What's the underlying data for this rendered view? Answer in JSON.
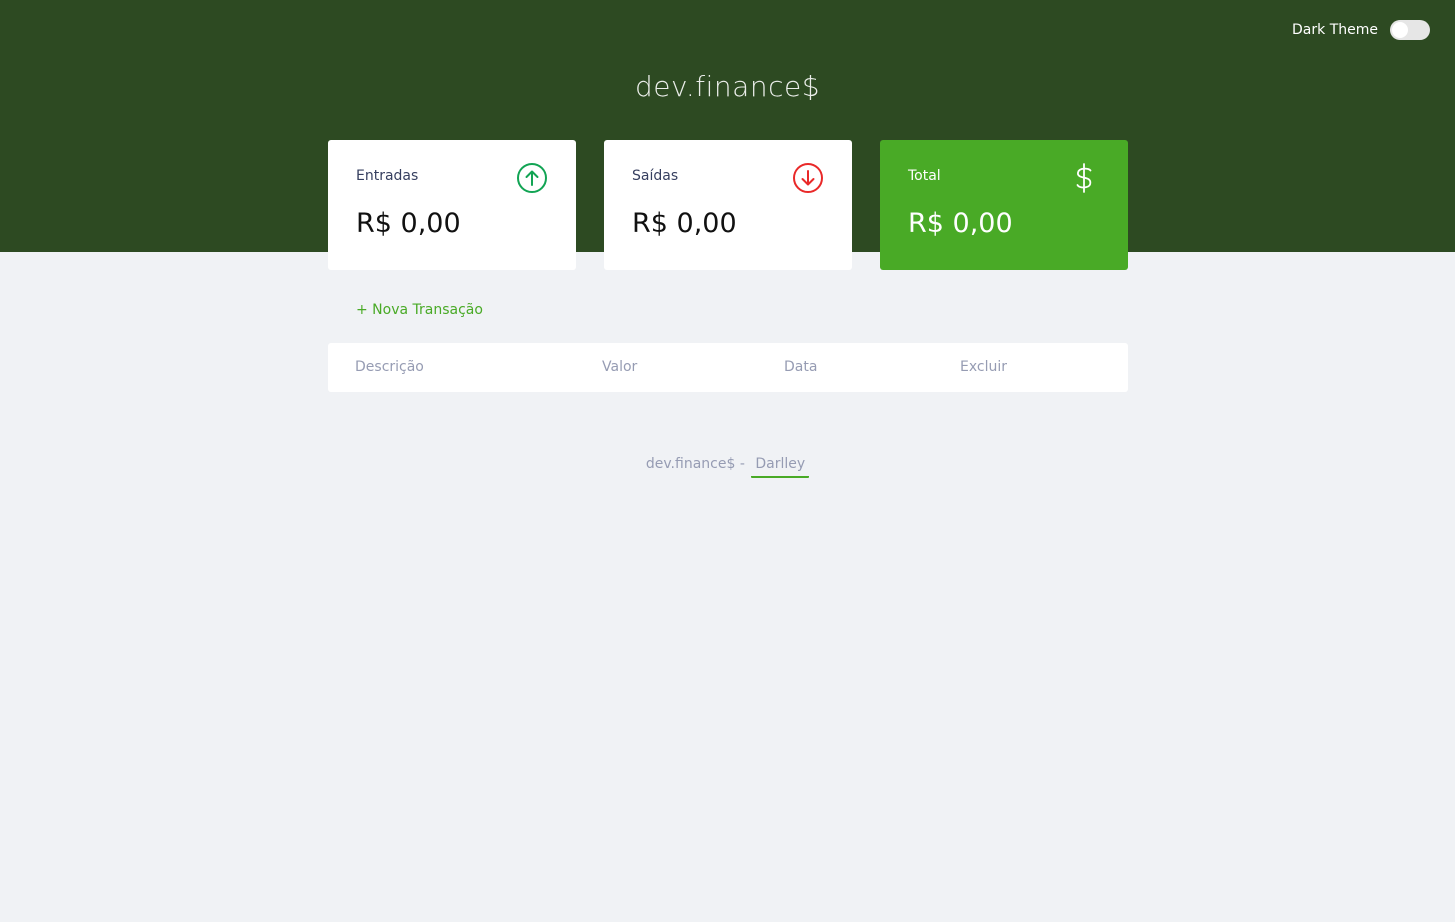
{
  "header": {
    "logo": "dev.finance$",
    "theme_label": "Dark Theme",
    "dark_theme_enabled": false
  },
  "cards": [
    {
      "title": "Entradas",
      "value": "R$ 0,00",
      "icon": "arrow-up-circle-icon",
      "icon_color": "#12A454"
    },
    {
      "title": "Saídas",
      "value": "R$ 0,00",
      "icon": "arrow-down-circle-icon",
      "icon_color": "#E92929"
    },
    {
      "title": "Total",
      "value": "R$ 0,00",
      "icon": "dollar-icon",
      "icon_color": "#FFFFFF"
    }
  ],
  "actions": {
    "new_transaction": "+ Nova Transação"
  },
  "table": {
    "columns": [
      "Descrição",
      "Valor",
      "Data",
      "Excluir"
    ],
    "rows": []
  },
  "footer": {
    "text": "dev.finance$ -",
    "author": "Darlley"
  },
  "colors": {
    "header_bg": "#2D4A22",
    "page_bg": "#F0F2F5",
    "accent": "#49AA26",
    "income": "#12A454",
    "expense": "#E92929"
  }
}
